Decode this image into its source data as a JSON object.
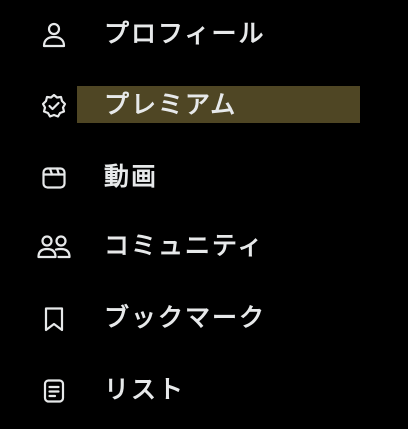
{
  "menu": {
    "items": [
      {
        "label": "プロフィール",
        "icon": "person-icon"
      },
      {
        "label": "プレミアム",
        "icon": "verified-badge-icon"
      },
      {
        "label": "動画",
        "icon": "clapperboard-icon"
      },
      {
        "label": "コミュニティ",
        "icon": "people-icon"
      },
      {
        "label": "ブックマーク",
        "icon": "bookmark-icon"
      },
      {
        "label": "リスト",
        "icon": "list-icon"
      }
    ],
    "highlighted_item": "プレミアム"
  },
  "colors": {
    "background": "#000000",
    "text": "#e7e9ea",
    "highlight": "#4f4624"
  }
}
